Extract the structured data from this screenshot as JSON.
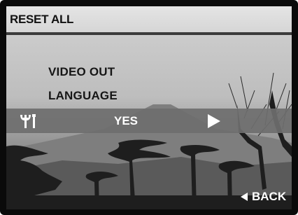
{
  "menu": {
    "title": "RESET ALL",
    "items": [
      "VIDEO OUT",
      "LANGUAGE"
    ],
    "selected_value": "YES"
  },
  "icons": {
    "settings": "wrench-tools-icon",
    "next": "right-arrow-icon",
    "back": "left-arrow-icon"
  },
  "back_label": "BACK",
  "colors": {
    "frame": "#0a0a0a",
    "title_rule": "#3b3b3b",
    "select_bar": "#6e6e6e",
    "text_dark": "#111111",
    "text_light": "#ffffff"
  }
}
